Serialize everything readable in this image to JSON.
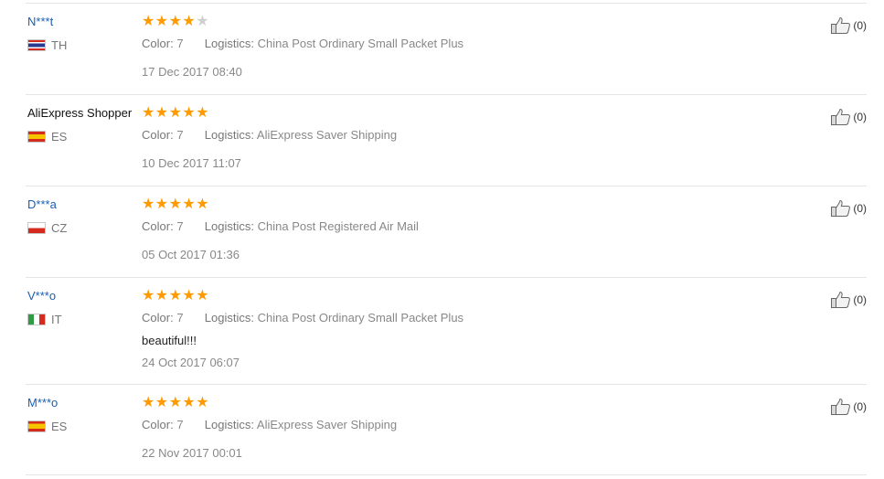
{
  "labels": {
    "color": "Color:",
    "logistics": "Logistics:"
  },
  "colors": {
    "star": "#ff9a00",
    "star_empty": "#cfcfcf",
    "username_link": "#1a5fb4"
  },
  "icons": {
    "helpful": "thumbs-up-icon"
  },
  "reviews": [
    {
      "user": "N***t",
      "country": "TH",
      "flag": "thailand-flag",
      "rating": 4,
      "color": "7",
      "logistics": "China Post Ordinary Small Packet Plus",
      "comment": "",
      "date": "17 Dec 2017 08:40",
      "helpful": "(0)"
    },
    {
      "user": "AliExpress Shopper",
      "country": "ES",
      "flag": "spain-flag",
      "rating": 5,
      "color": "7",
      "logistics": "AliExpress Saver Shipping",
      "comment": "",
      "date": "10 Dec 2017 11:07",
      "helpful": "(0)"
    },
    {
      "user": "D***a",
      "country": "CZ",
      "flag": "czech-flag",
      "rating": 5,
      "color": "7",
      "logistics": "China Post Registered Air Mail",
      "comment": "",
      "date": "05 Oct 2017 01:36",
      "helpful": "(0)"
    },
    {
      "user": "V***o",
      "country": "IT",
      "flag": "italy-flag",
      "rating": 5,
      "color": "7",
      "logistics": "China Post Ordinary Small Packet Plus",
      "comment": "beautiful!!!",
      "date": "24 Oct 2017 06:07",
      "helpful": "(0)"
    },
    {
      "user": "M***o",
      "country": "ES",
      "flag": "spain-flag",
      "rating": 5,
      "color": "7",
      "logistics": "AliExpress Saver Shipping",
      "comment": "",
      "date": "22 Nov 2017 00:01",
      "helpful": "(0)"
    }
  ]
}
